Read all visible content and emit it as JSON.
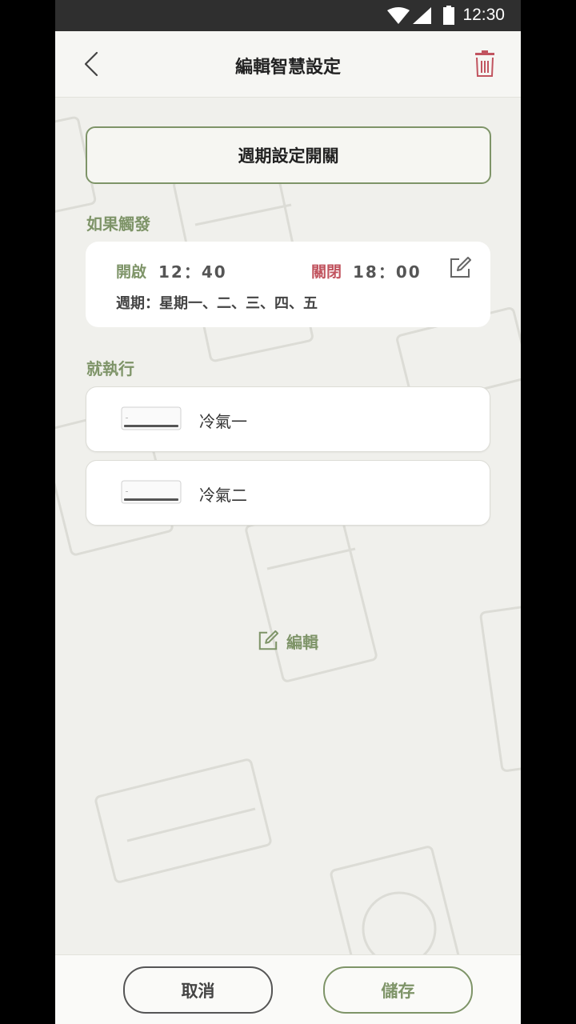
{
  "status_bar": {
    "time": "12:30"
  },
  "header": {
    "title": "編輯智慧設定"
  },
  "schedule": {
    "toggle_label": "週期設定開關"
  },
  "trigger": {
    "section_label": "如果觸發",
    "on_label": "開啟",
    "on_time": "12：40",
    "off_label": "關閉",
    "off_time": "18：00",
    "weekdays": "週期：星期一、二、三、四、五"
  },
  "actions": {
    "section_label": "就執行",
    "devices": [
      {
        "name": "冷氣一"
      },
      {
        "name": "冷氣二"
      }
    ],
    "edit_label": "編輯"
  },
  "footer": {
    "cancel_label": "取消",
    "save_label": "儲存"
  },
  "colors": {
    "accent": "#7e9468",
    "danger": "#c1545f",
    "background": "#f0f0ec"
  }
}
